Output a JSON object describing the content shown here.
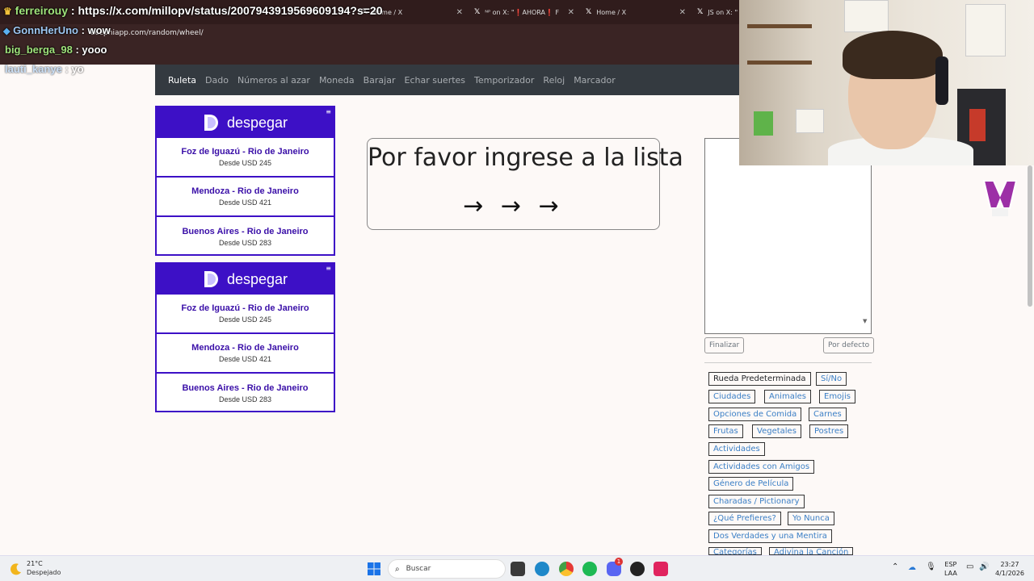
{
  "browser": {
    "tabs": [
      {
        "label": "Home / X"
      },
      {
        "label": "ᴺᴾ on X: \"❗AHORA❗ F"
      },
      {
        "label": "Home / X"
      },
      {
        "label": "JS on X: \""
      }
    ],
    "address": "ecephiapp.com/random/wheel/"
  },
  "chat": [
    {
      "user": "ferreirouy",
      "message": ": https://x.com/millopv/status/200794391956960919​4?s=20"
    },
    {
      "user": "GonnHerUno",
      "message": ": wow"
    },
    {
      "user": "big_berga_98",
      "message": ": yooo"
    },
    {
      "user": "lauti_kanye",
      "message": ": yo"
    }
  ],
  "nav": {
    "items": [
      "Ruleta",
      "Dado",
      "Números al azar",
      "Moneda",
      "Barajar",
      "Echar suertes",
      "Temporizador",
      "Reloj",
      "Marcador"
    ],
    "active": "Ruleta"
  },
  "ads": [
    {
      "brand": "despegar",
      "routes": [
        {
          "name": "Foz de Iguazú - Rio de Janeiro",
          "price": "Desde USD 245"
        },
        {
          "name": "Mendoza - Rio de Janeiro",
          "price": "Desde USD 421"
        },
        {
          "name": "Buenos Aires - Rio de Janeiro",
          "price": "Desde USD 283"
        }
      ]
    },
    {
      "brand": "despegar",
      "routes": [
        {
          "name": "Foz de Iguazú - Rio de Janeiro",
          "price": "Desde USD 245"
        },
        {
          "name": "Mendoza - Rio de Janeiro",
          "price": "Desde USD 421"
        },
        {
          "name": "Buenos Aires - Rio de Janeiro",
          "price": "Desde USD 283"
        }
      ]
    }
  ],
  "wheel": {
    "message": "Por favor ingrese a la lista",
    "arrows": "→ → →"
  },
  "list": {
    "value": "",
    "finalize_label": "Finalizar",
    "default_label": "Por defecto"
  },
  "presets": [
    "Rueda Predeterminada",
    "Sí/No",
    "Ciudades",
    "Animales",
    "Emojis",
    "Opciones de Comida",
    "Carnes",
    "Frutas",
    "Vegetales",
    "Postres",
    "Actividades",
    "Actividades con Amigos",
    "Género de Película",
    "Charadas / Pictionary",
    "¿Qué Prefieres?",
    "Yo Nunca",
    "Dos Verdades y una Mentira",
    "Categorías",
    "Adivina la Canción"
  ],
  "taskbar": {
    "temperature": "21°C",
    "weather": "Despejado",
    "search_placeholder": "Buscar",
    "lang_top": "ESP",
    "lang_bottom": "LAA",
    "time": "23:27",
    "date": "4/1/2026",
    "notification_count": "1"
  },
  "colors": {
    "navbar": "#343a40",
    "brand_purple": "#3d10c6",
    "link_blue": "#3a7fc6"
  }
}
